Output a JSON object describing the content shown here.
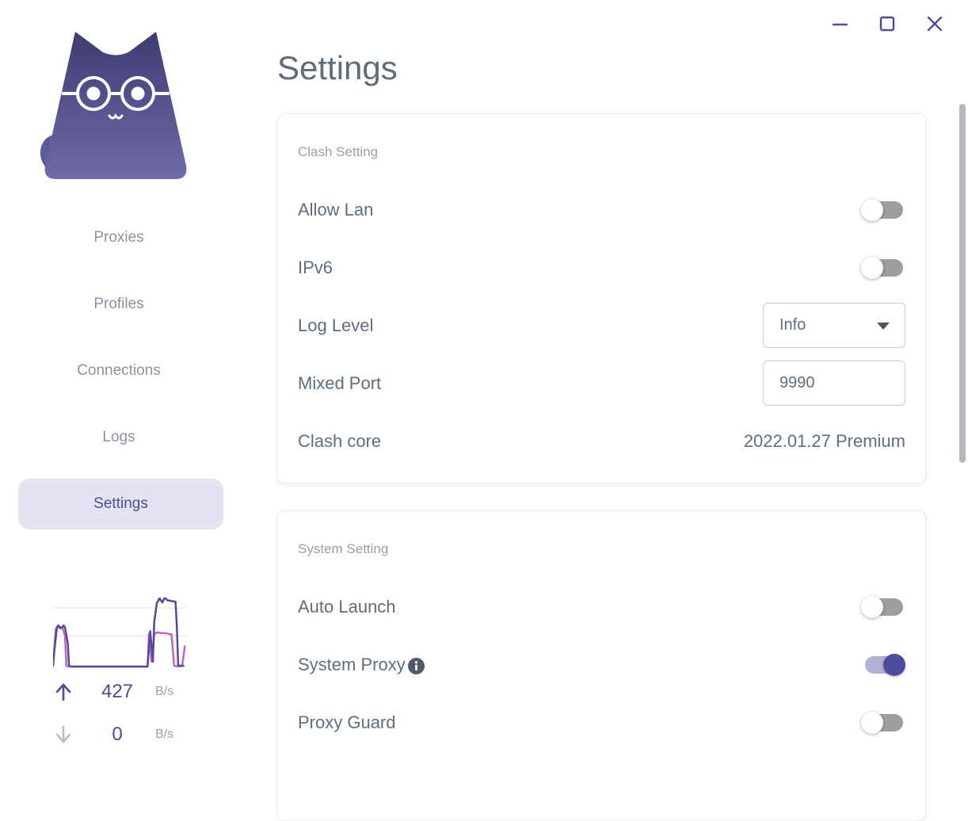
{
  "colors": {
    "primary": "#4f4c9e",
    "primary_light_track": "#b2afd5",
    "upload_line": "#4f4c9e",
    "download_line": "#c563c5",
    "nav_text": "#8d91a2",
    "nav_active_text": "#4c4a9c",
    "nav_active_bg": "#e4e3f1",
    "title_text": "#5e6c7d",
    "label_text": "#5f6e7e",
    "section_header_text": "#9b9ea6",
    "muted_unit_text": "#9aa0ab",
    "toggle_off_track": "#9e9e9e",
    "input_border": "#c9cdd2",
    "scrollbar_thumb": "#b4b6bd",
    "window_button": "#4c4aa8",
    "info_icon_bg": "#4e5a68"
  },
  "icons": {
    "minimize": "–",
    "maximize": "▢",
    "close": "✕",
    "upload_arrow": "↑",
    "download_arrow": "↓",
    "info": "ⓘ",
    "dropdown_caret": "▼",
    "logo": "clash-cat"
  },
  "header": {
    "title": "Settings"
  },
  "sidebar": {
    "items": [
      {
        "label": "Proxies",
        "active": false
      },
      {
        "label": "Profiles",
        "active": false
      },
      {
        "label": "Connections",
        "active": false
      },
      {
        "label": "Logs",
        "active": false
      },
      {
        "label": "Settings",
        "active": true
      }
    ],
    "traffic": {
      "upload": {
        "value": "427",
        "unit": "B/s"
      },
      "download": {
        "value": "0",
        "unit": "B/s"
      }
    }
  },
  "cards": [
    {
      "section": "Clash Setting",
      "rows": [
        {
          "label": "Allow Lan",
          "control": "toggle",
          "state": "off"
        },
        {
          "label": "IPv6",
          "control": "toggle",
          "state": "off"
        },
        {
          "label": "Log Level",
          "control": "select",
          "value": "Info"
        },
        {
          "label": "Mixed Port",
          "control": "input",
          "value": "9990"
        },
        {
          "label": "Clash core",
          "control": "text",
          "value": "2022.01.27 Premium"
        }
      ]
    },
    {
      "section": "System Setting",
      "rows": [
        {
          "label": "Auto Launch",
          "control": "toggle",
          "state": "off"
        },
        {
          "label": "System Proxy",
          "control": "toggle",
          "state": "on",
          "info": true
        },
        {
          "label": "Proxy Guard",
          "control": "toggle",
          "state": "off"
        }
      ]
    }
  ],
  "chart_data": {
    "type": "line",
    "title": "",
    "note": "sidebar traffic sparkline, no axis labels shown; values are relative 0-100 (percent of plot height), x is percent of plot width",
    "grid": true,
    "gridlines_rel": [
      0.45,
      0.85
    ],
    "legend": "none",
    "series": [
      {
        "name": "download",
        "color": "#c563c5",
        "points": [
          [
            0,
            2
          ],
          [
            1,
            30
          ],
          [
            2,
            55
          ],
          [
            4,
            58
          ],
          [
            5,
            56
          ],
          [
            7,
            57
          ],
          [
            9,
            45
          ],
          [
            10,
            2
          ],
          [
            12,
            1
          ],
          [
            71,
            1
          ],
          [
            72,
            48
          ],
          [
            74,
            8
          ],
          [
            76,
            47
          ],
          [
            78,
            50
          ],
          [
            81,
            49
          ],
          [
            84,
            49
          ],
          [
            87,
            48
          ],
          [
            89,
            47
          ],
          [
            90,
            25
          ],
          [
            91,
            2
          ],
          [
            94,
            1
          ],
          [
            97,
            2
          ],
          [
            99,
            30
          ]
        ]
      },
      {
        "name": "upload",
        "color": "#4f4c9e",
        "points": [
          [
            0,
            2
          ],
          [
            1,
            25
          ],
          [
            3,
            58
          ],
          [
            4,
            60
          ],
          [
            6,
            56
          ],
          [
            8,
            60
          ],
          [
            9,
            57
          ],
          [
            11,
            35
          ],
          [
            12,
            2
          ],
          [
            14,
            1
          ],
          [
            71,
            1
          ],
          [
            73,
            52
          ],
          [
            75,
            8
          ],
          [
            76,
            65
          ],
          [
            78,
            92
          ],
          [
            80,
            99
          ],
          [
            82,
            93
          ],
          [
            84,
            100
          ],
          [
            86,
            96
          ],
          [
            89,
            95
          ],
          [
            92,
            94
          ],
          [
            93,
            60
          ],
          [
            94,
            3
          ],
          [
            96,
            2
          ],
          [
            98,
            2
          ]
        ]
      }
    ]
  }
}
